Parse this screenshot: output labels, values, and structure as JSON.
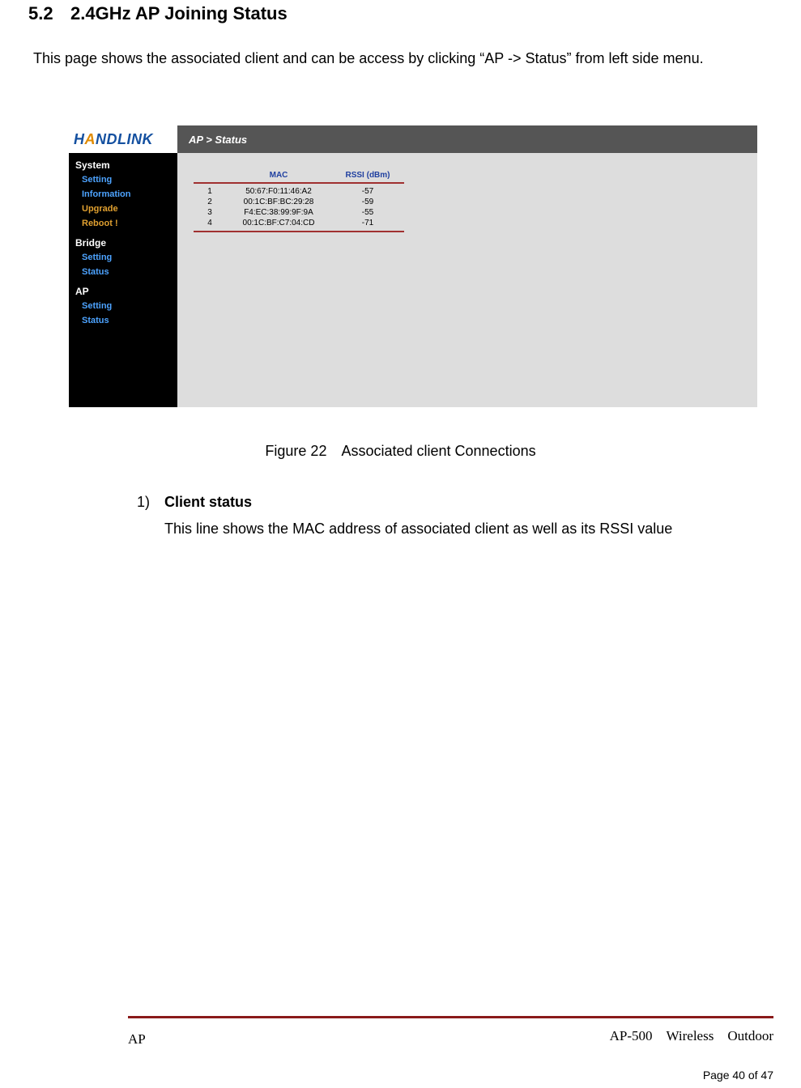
{
  "section": {
    "number": "5.2",
    "title": "2.4GHz AP Joining Status"
  },
  "intro": "This page shows the associated client and can be access by clicking “AP -> Status” from left side menu.",
  "screenshot": {
    "logo_text_1": "H",
    "logo_text_2": "A",
    "logo_text_3": "NDLINK",
    "breadcrumb": "AP > Status",
    "nav": {
      "system": {
        "heading": "System",
        "items": [
          "Setting",
          "Information",
          "Upgrade",
          "Reboot !"
        ]
      },
      "bridge": {
        "heading": "Bridge",
        "items": [
          "Setting",
          "Status"
        ]
      },
      "ap": {
        "heading": "AP",
        "items": [
          "Setting",
          "Status"
        ]
      }
    },
    "table": {
      "headers": {
        "mac": "MAC",
        "rssi": "RSSI (dBm)"
      },
      "rows": [
        {
          "idx": "1",
          "mac": "50:67:F0:11:46:A2",
          "rssi": "-57"
        },
        {
          "idx": "2",
          "mac": "00:1C:BF:BC:29:28",
          "rssi": "-59"
        },
        {
          "idx": "3",
          "mac": "F4:EC:38:99:9F:9A",
          "rssi": "-55"
        },
        {
          "idx": "4",
          "mac": "00:1C:BF:C7:04:CD",
          "rssi": "-71"
        }
      ]
    }
  },
  "figure_caption": "Figure 22 Associated client Connections",
  "list": {
    "num": "1)",
    "title": "Client status",
    "desc": "This line shows the MAC address of associated client as well as its RSSI value"
  },
  "footer": {
    "model": "AP-500 Wireless Outdoor",
    "line2": "AP",
    "page": "Page 40 of 47"
  }
}
